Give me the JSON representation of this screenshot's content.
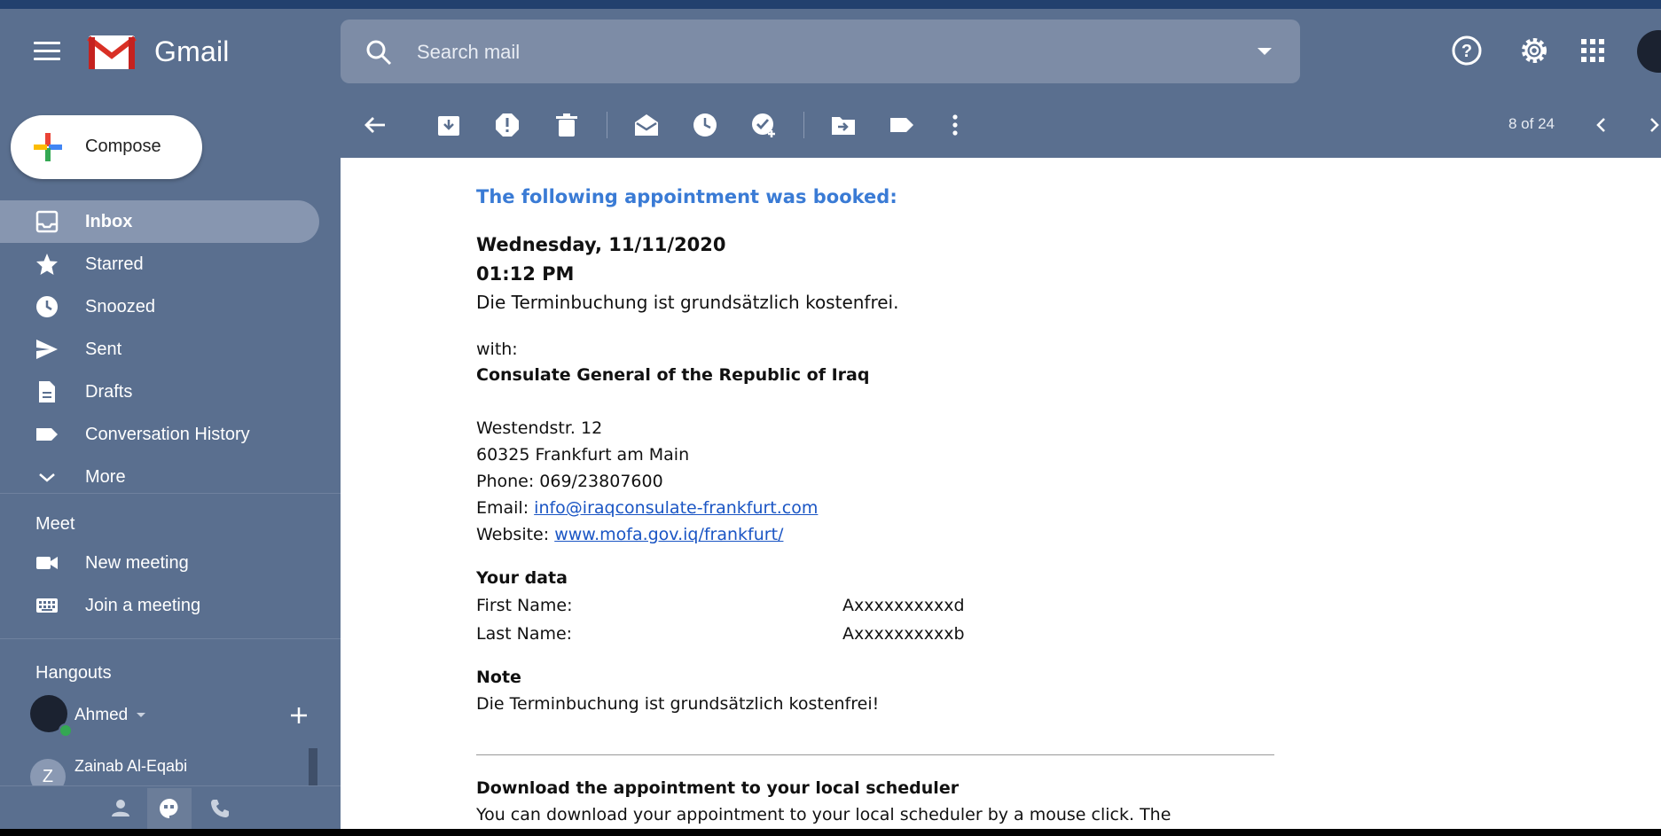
{
  "app": {
    "name": "Gmail"
  },
  "search": {
    "placeholder": "Search mail"
  },
  "compose": {
    "label": "Compose"
  },
  "nav": [
    {
      "label": "Inbox",
      "icon": "inbox-icon",
      "active": true
    },
    {
      "label": "Starred",
      "icon": "star-icon"
    },
    {
      "label": "Snoozed",
      "icon": "clock-icon"
    },
    {
      "label": "Sent",
      "icon": "send-icon"
    },
    {
      "label": "Drafts",
      "icon": "draft-icon"
    },
    {
      "label": "Conversation History",
      "icon": "label-icon"
    },
    {
      "label": "More",
      "icon": "chevron-down-icon"
    }
  ],
  "meet": {
    "title": "Meet",
    "new_meeting": "New meeting",
    "join_meeting": "Join a meeting"
  },
  "hangouts": {
    "title": "Hangouts",
    "user": "Ahmed",
    "contact_name": "Zainab Al-Eqabi",
    "contact_initial": "Z"
  },
  "pager": {
    "text": "8 of 24"
  },
  "email": {
    "heading": "The following appointment was booked:",
    "date": "Wednesday, 11/11/2020",
    "time": "01:12 PM",
    "fee_note": "Die Terminbuchung ist grundsätzlich kostenfrei.",
    "with_label": "with:",
    "organization": "Consulate General of the Republic of Iraq",
    "street": "Westendstr. 12",
    "city": "60325 Frankfurt am Main",
    "phone": "Phone: 069/23807600",
    "email_label": "Email:",
    "email_value": "info@iraqconsulate-frankfurt.com",
    "website_label": "Website:",
    "website_value": "www.mofa.gov.iq/frankfurt/",
    "your_data": "Your data",
    "first_name_label": "First Name:",
    "first_name_value": "Axxxxxxxxxxd",
    "last_name_label": "Last Name:",
    "last_name_value": "Axxxxxxxxxxb",
    "note_title": "Note",
    "note_text": "Die Terminbuchung ist grundsätzlich kostenfrei!",
    "download_title": "Download the appointment to your local scheduler",
    "download_text": "You can download your appointment to your local scheduler by a mouse click. The"
  },
  "colors": {
    "header_bg": "#5a6f8f",
    "search_bg": "#7d8ca6",
    "active_nav": "#8796b0",
    "heading_blue": "#3a7bd5",
    "link_blue": "#1a55c4"
  }
}
